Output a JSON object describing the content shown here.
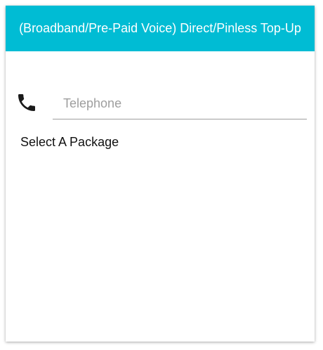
{
  "header": {
    "title": "(Broadband/Pre-Paid Voice) Direct/Pinless Top-Up"
  },
  "form": {
    "phone_icon": "phone-icon",
    "telephone_placeholder": "Telephone",
    "telephone_value": "",
    "package_label": "Select A Package"
  },
  "colors": {
    "header_bg": "#00bcd4",
    "header_text": "#ffffff",
    "input_underline": "#9e9e9e"
  }
}
